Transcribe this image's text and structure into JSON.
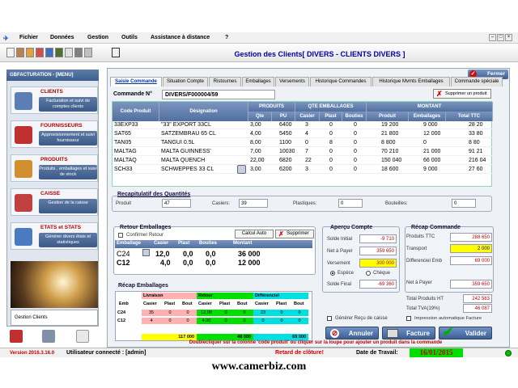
{
  "menu": [
    "Fichier",
    "Données",
    "Gestion",
    "Outils",
    "Assistance à distance",
    "?"
  ],
  "page_title": "Gestion des Clients[ DIVERS - CLIENTS DIVERS ]",
  "sidebar": {
    "header": "GBFACTURATION - [MENU]",
    "sections": [
      {
        "label": "CLIENTS",
        "sub": "Facturation et suivi de comptes clients"
      },
      {
        "label": "FOURNISSEURS",
        "sub": "Approvisionnement et suivi fournisseur"
      },
      {
        "label": "PRODUITS",
        "sub": "Produits , emballages et suivi de stock"
      },
      {
        "label": "CAISSE",
        "sub": "Gestion de la caisse"
      },
      {
        "label": "ETATS et STATS",
        "sub": "Générer divers états et statistiques"
      }
    ],
    "gestion_clients": "Gestion Clients"
  },
  "fermer": "Fermer",
  "tabs": [
    "Saisie Commande",
    "Situation Compte",
    "Ristournes",
    "Emballages",
    "Versements",
    "Historique Commandes",
    "Historique Mvmts Emballages",
    "Commande spéciale"
  ],
  "commande": {
    "label": "Commande N°",
    "value": "DIVERS/F000004/59",
    "supprimer": "Supprimer un produit"
  },
  "grid": {
    "headers": {
      "code": "Code Produit",
      "designation": "Désignation",
      "produits": "PRODUITS",
      "qte": "Qte",
      "pu": "PU",
      "qte_emb": "QTE EMBALLAGES",
      "casier": "Casier",
      "plast": "Plast",
      "bouties": "Bouties",
      "montant": "MONTANT",
      "produit": "Produit",
      "emballages": "Emballages",
      "total": "Total TTC"
    },
    "rows": [
      {
        "code": "33EXP33",
        "des": "\"33\" EXPORT 33CL",
        "qte": "3,00",
        "pu": "6400",
        "casier": "3",
        "plast": "0",
        "bout": "0",
        "produit": "19 200",
        "emb": "9 000",
        "total": "28 20"
      },
      {
        "code": "SAT65",
        "des": "SATZEMBRAU 65 CL",
        "qte": "4,00",
        "pu": "5450",
        "casier": "4",
        "plast": "0",
        "bout": "0",
        "produit": "21 800",
        "emb": "12 000",
        "total": "33 80"
      },
      {
        "code": "TAN05",
        "des": "TANGUI 0.5L",
        "qte": "8,00",
        "pu": "1100",
        "casier": "0",
        "plast": "8",
        "bout": "0",
        "produit": "8 800",
        "emb": "0",
        "total": "8 80"
      },
      {
        "code": "MALTAG",
        "des": "MALTA GUINNESS'",
        "qte": "7,00",
        "pu": "10030",
        "casier": "7",
        "plast": "0",
        "bout": "0",
        "produit": "70 210",
        "emb": "21 000",
        "total": "91 21"
      },
      {
        "code": "MALTAQ",
        "des": "MALTA QUENCH",
        "qte": "22,00",
        "pu": "6820",
        "casier": "22",
        "plast": "0",
        "bout": "0",
        "produit": "150 040",
        "emb": "66 000",
        "total": "216 04"
      },
      {
        "code": "SCH33",
        "des": "SCHWEPPES 33 CL",
        "qte": "3,00",
        "pu": "6200",
        "casier": "3",
        "plast": "0",
        "bout": "0",
        "produit": "18 600",
        "emb": "9 000",
        "total": "27 60"
      }
    ]
  },
  "recap_qte": {
    "title": "Recapitulatif des Quantités",
    "produit_label": "Produit",
    "produit": "47",
    "casiers_label": "Casiers:",
    "casiers": "39",
    "plastiques_label": "Plastiques:",
    "plastiques": "0",
    "bouteilles_label": "Bouteilles:",
    "bouteilles": "0"
  },
  "retour": {
    "title": "Retour Emballages",
    "confirmer": "Confirmer Retour",
    "calcul": "Calcul Auto",
    "supprimer": "Supprimer",
    "headers": [
      "Emballage",
      "Casier",
      "Plast",
      "Bouties",
      "Montant"
    ],
    "rows": [
      {
        "emb": "C24",
        "casier": "12,0",
        "plast": "0,0",
        "bout": "0,0",
        "montant": "36 000"
      },
      {
        "emb": "C12",
        "casier": "4,0",
        "plast": "0,0",
        "bout": "0,0",
        "montant": "12 000"
      }
    ]
  },
  "recap_emb": {
    "title": "Récap Emballages",
    "groups": [
      "Livraison",
      "Retour",
      "Différenciel"
    ],
    "headers": [
      "Emb",
      "Casier",
      "Plast",
      "Bout",
      "Casier",
      "Plast",
      "Bout",
      "Casier",
      "Plast",
      "Bout"
    ],
    "rows": [
      {
        "emb": "C24",
        "vals": [
          "35",
          "0",
          "0",
          "12,00",
          "0",
          "0",
          "23",
          "0",
          "0"
        ]
      },
      {
        "emb": "C12",
        "vals": [
          "4",
          "0",
          "0",
          "4,00",
          "0",
          "0",
          "0",
          "0",
          "0"
        ]
      }
    ],
    "totals": [
      "117 000",
      "48 000",
      "69 000"
    ]
  },
  "apercu": {
    "title": "Aperçu Compte",
    "solde_initial_label": "Solde Initial",
    "solde_initial": "-9 710",
    "net_label": "Net à Payer",
    "net": "359 650",
    "versement_label": "Versement",
    "versement": "300 000",
    "espece": "Espèce",
    "cheque": "Chèque",
    "solde_final_label": "Solde Final",
    "solde_final": "-69 360"
  },
  "recap_cmd": {
    "title": "Récap Commande",
    "produits_ttc_label": "Produits TTC",
    "produits_ttc": "288 650",
    "transport_label": "Transport",
    "transport": "2 000",
    "diff_label": "Differenciel Emb",
    "diff": "69 000",
    "net_label": "Net à Payer",
    "net": "359 650",
    "total_ht_label": "Total Produits HT",
    "total_ht": "242 563",
    "tva_label": "Total TVA(19%)",
    "tva": "46 087"
  },
  "options": {
    "recu": "Générer Reçu de caisse",
    "impression": "Impression automatique Facture"
  },
  "buttons": {
    "annuler": "Annuler",
    "facture": "Facture",
    "valider": "Valider"
  },
  "message": "Doublecliquer sur la colonne 'code produit' ou cliquer sur la loupe pour ajouter un produit dans la commande",
  "status": {
    "version": "Version 2016.3.16.0",
    "user": "Utilisateur connecté : [admin]",
    "retard": "Retard de clôture!",
    "date_label": "Date de Travail:",
    "date": "16/01/2015"
  },
  "footer": "www.camerbiz.com",
  "colors": {
    "accent": "#3b5d91",
    "red": "#c00000",
    "yellow": "#ffff00",
    "green": "#00c000",
    "cyan": "#00e0e0",
    "livraison": "#ffb0b0"
  }
}
